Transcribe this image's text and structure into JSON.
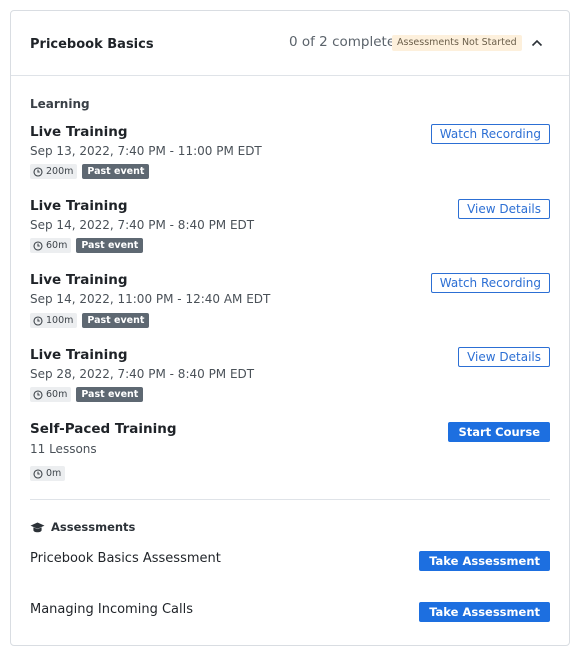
{
  "header": {
    "title": "Pricebook Basics",
    "progress": "0 of 2 completed",
    "status_badge": "Assessments Not Started"
  },
  "learning": {
    "label": "Learning",
    "items": [
      {
        "title": "Live Training",
        "subtitle": "Sep 13, 2022, 7:40 PM - 11:00 PM EDT",
        "duration": "200m",
        "tag": "Past event",
        "action": "Watch Recording"
      },
      {
        "title": "Live Training",
        "subtitle": "Sep 14, 2022, 7:40 PM - 8:40 PM EDT",
        "duration": "60m",
        "tag": "Past event",
        "action": "View Details"
      },
      {
        "title": "Live Training",
        "subtitle": "Sep 14, 2022, 11:00 PM - 12:40 AM EDT",
        "duration": "100m",
        "tag": "Past event",
        "action": "Watch Recording"
      },
      {
        "title": "Live Training",
        "subtitle": "Sep 28, 2022, 7:40 PM - 8:40 PM EDT",
        "duration": "60m",
        "tag": "Past event",
        "action": "View Details"
      },
      {
        "title": "Self-Paced Training",
        "subtitle": "11 Lessons",
        "duration": "0m",
        "action": "Start Course"
      }
    ]
  },
  "assessments": {
    "label": "Assessments",
    "icon": "graduation-cap-icon",
    "items": [
      {
        "title": "Pricebook Basics Assessment",
        "action": "Take Assessment"
      },
      {
        "title": "Managing Incoming Calls",
        "action": "Take Assessment"
      }
    ]
  },
  "colors": {
    "primary": "#1d6fe0",
    "badge_bg": "#fdf0dc",
    "past_event_bg": "#5e6872"
  }
}
